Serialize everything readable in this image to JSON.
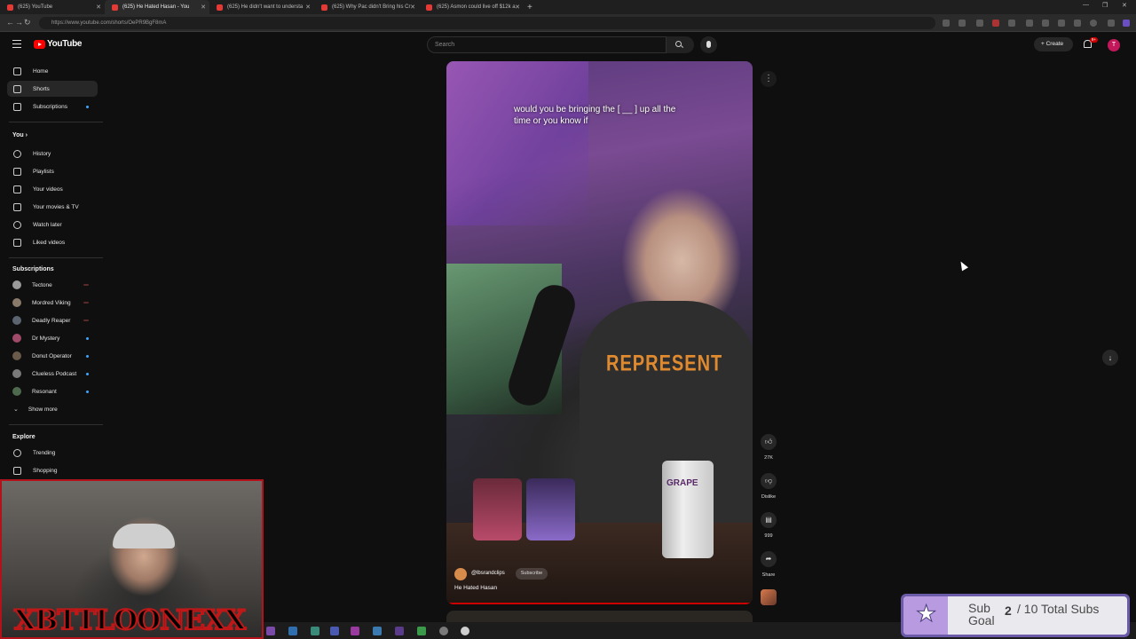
{
  "browser": {
    "tabs": [
      {
        "title": "(625) YouTube"
      },
      {
        "title": "(625) He Hated Hasan - You"
      },
      {
        "title": "(625) He didn't want to understa"
      },
      {
        "title": "(625) Why Pac didn't Bring his Cr"
      },
      {
        "title": "(625) Asmon could live off $12k a"
      }
    ],
    "new_tab": "+",
    "url": "https://www.youtube.com/shorts/OePR9BgF8mA"
  },
  "header": {
    "logo_text": "YouTube",
    "search_placeholder": "Search",
    "create_label": "+ Create",
    "notification_count": "9+",
    "avatar_letter": "T"
  },
  "sidebar": {
    "main": [
      {
        "label": "Home",
        "icon": "home-icon"
      },
      {
        "label": "Shorts",
        "icon": "shorts-icon"
      },
      {
        "label": "Subscriptions",
        "icon": "subscriptions-icon"
      }
    ],
    "you_heading": "You  ›",
    "you": [
      {
        "label": "History",
        "icon": "history-icon"
      },
      {
        "label": "Playlists",
        "icon": "playlists-icon"
      },
      {
        "label": "Your videos",
        "icon": "your-videos-icon"
      },
      {
        "label": "Your movies & TV",
        "icon": "movies-icon"
      },
      {
        "label": "Watch later",
        "icon": "watch-later-icon"
      },
      {
        "label": "Liked videos",
        "icon": "liked-icon"
      }
    ],
    "subs_heading": "Subscriptions",
    "subscriptions": [
      {
        "label": "Tectone"
      },
      {
        "label": "Mordred Viking"
      },
      {
        "label": "Deadly Reaper"
      },
      {
        "label": "Dr Mystery"
      },
      {
        "label": "Donut Operator"
      },
      {
        "label": "Clueless Podcast"
      },
      {
        "label": "Resonant"
      }
    ],
    "show_more": "Show more",
    "explore_heading": "Explore",
    "explore": [
      {
        "label": "Trending",
        "icon": "trending-icon"
      },
      {
        "label": "Shopping",
        "icon": "shopping-icon"
      }
    ]
  },
  "short": {
    "caption": "would you be bringing the [ __ ] up all the time or you know if",
    "shirt_text": "REPRESENT",
    "can_text": "GRAPE",
    "channel": "@lbsrandclips",
    "subscribe_label": "Subscribe",
    "title": "He Hated Hasan",
    "likes": "27K",
    "dislike_label": "Dislike",
    "comments": "999",
    "share_label": "Share"
  },
  "overlay": {
    "webcam_name": "XBTTLOONEXX",
    "subgoal_label": "Sub Goal",
    "subgoal_current": "2",
    "subgoal_total": "/ 10 Total Subs"
  }
}
